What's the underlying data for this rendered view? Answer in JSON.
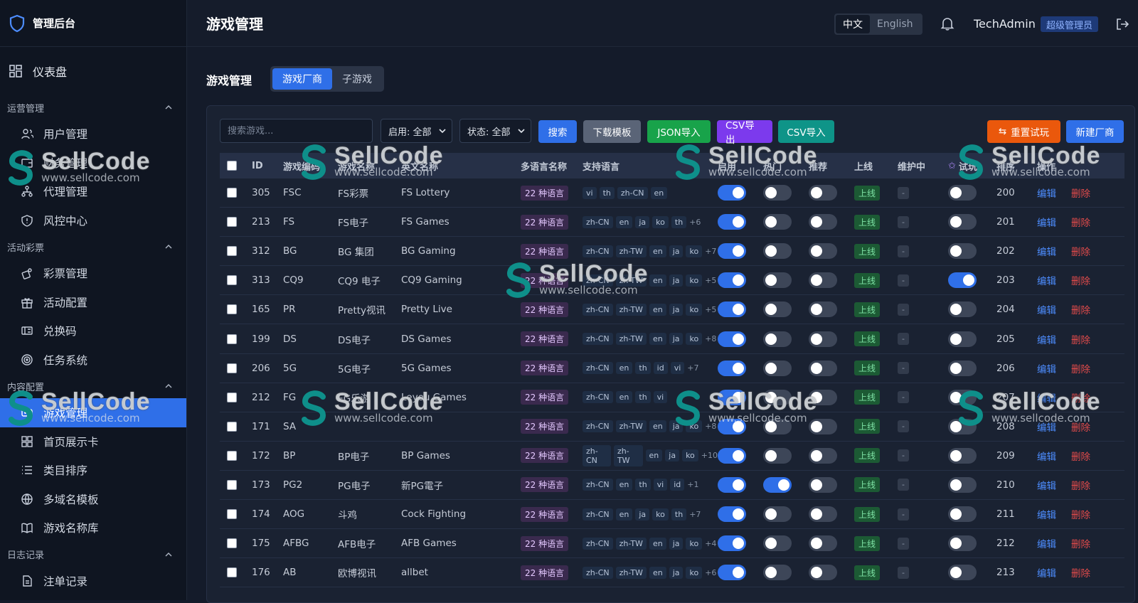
{
  "brand": {
    "title": "管理后台"
  },
  "sidebar": {
    "dashboard": "仪表盘",
    "sections": [
      {
        "title": "运营管理",
        "items": [
          "用户管理",
          "财务管理",
          "代理管理",
          "风控中心"
        ]
      },
      {
        "title": "活动彩票",
        "items": [
          "彩票管理",
          "活动配置",
          "兑换码",
          "任务系统"
        ]
      },
      {
        "title": "内容配置",
        "items": [
          "游戏管理",
          "首页展示卡",
          "类目排序",
          "多域名模板",
          "游戏名称库"
        ]
      },
      {
        "title": "日志记录",
        "items": [
          "注单记录"
        ]
      }
    ],
    "active_item": "游戏管理"
  },
  "header": {
    "title": "游戏管理",
    "lang": {
      "zh": "中文",
      "en": "English",
      "active": "中文"
    },
    "user": "TechAdmin",
    "role": "超级管理员"
  },
  "main": {
    "subtitle": "游戏管理",
    "tabs": [
      {
        "label": "游戏厂商",
        "active": true
      },
      {
        "label": "子游戏",
        "active": false
      }
    ]
  },
  "toolbar": {
    "search_placeholder": "搜索游戏...",
    "filter_enable": "启用: 全部",
    "filter_status": "状态: 全部",
    "search": "搜索",
    "download_template": "下载模板",
    "json_import": "JSON导入",
    "csv_export": "CSV导出",
    "csv_import": "CSV导入",
    "reset_trial": "重置试玩",
    "new_vendor": "新建厂商"
  },
  "table": {
    "headers": [
      "ID",
      "游戏编码",
      "游戏名称",
      "英文名称",
      "多语言名称",
      "支持语言",
      "启用",
      "热门",
      "推荐",
      "上线",
      "维护中",
      "试玩",
      "排序",
      "操作"
    ],
    "multi_label": "22 种语言",
    "online_label": "上线",
    "maint_label": "-",
    "edit_label": "编辑",
    "delete_label": "删除",
    "rows": [
      {
        "id": "305",
        "code": "FSC",
        "name": "FS彩票",
        "ename": "FS Lottery",
        "langs": [
          "vi",
          "th",
          "zh-CN",
          "en"
        ],
        "more": "",
        "t1": true,
        "t2": false,
        "t3": false,
        "trial": false,
        "sort": "200"
      },
      {
        "id": "213",
        "code": "FS",
        "name": "FS电子",
        "ename": "FS Games",
        "langs": [
          "zh-CN",
          "en",
          "ja",
          "ko",
          "th"
        ],
        "more": "+6",
        "t1": true,
        "t2": false,
        "t3": false,
        "trial": false,
        "sort": "201"
      },
      {
        "id": "312",
        "code": "BG",
        "name": "BG 集团",
        "ename": "BG Gaming",
        "langs": [
          "zh-CN",
          "zh-TW",
          "en",
          "ja",
          "ko"
        ],
        "more": "+7",
        "t1": true,
        "t2": false,
        "t3": false,
        "trial": false,
        "sort": "202"
      },
      {
        "id": "313",
        "code": "CQ9",
        "name": "CQ9 电子",
        "ename": "CQ9 Gaming",
        "langs": [
          "zh-CN",
          "zh-TW",
          "en",
          "ja",
          "ko"
        ],
        "more": "+5",
        "t1": true,
        "t2": false,
        "t3": false,
        "trial": true,
        "sort": "203"
      },
      {
        "id": "165",
        "code": "PR",
        "name": "Pretty视讯",
        "ename": "Pretty Live",
        "langs": [
          "zh-CN",
          "zh-TW",
          "en",
          "ja",
          "ko"
        ],
        "more": "+5",
        "t1": true,
        "t2": false,
        "t3": false,
        "trial": false,
        "sort": "204"
      },
      {
        "id": "199",
        "code": "DS",
        "name": "DS电子",
        "ename": "DS Games",
        "langs": [
          "zh-CN",
          "zh-TW",
          "en",
          "ja",
          "ko"
        ],
        "more": "+8",
        "t1": true,
        "t2": false,
        "t3": false,
        "trial": false,
        "sort": "205"
      },
      {
        "id": "206",
        "code": "5G",
        "name": "5G电子",
        "ename": "5G Games",
        "langs": [
          "zh-CN",
          "en",
          "th",
          "id",
          "vi"
        ],
        "more": "+7",
        "t1": true,
        "t2": false,
        "t3": false,
        "trial": false,
        "sort": "206"
      },
      {
        "id": "212",
        "code": "FG",
        "name": "FG乐游",
        "ename": "Leyou Games",
        "langs": [
          "zh-CN",
          "en",
          "th",
          "vi"
        ],
        "more": "",
        "t1": true,
        "t2": false,
        "t3": false,
        "trial": false,
        "sort": "207"
      },
      {
        "id": "171",
        "code": "SA",
        "name": "",
        "ename": "",
        "langs": [
          "zh-CN",
          "zh-TW",
          "en",
          "ja",
          "ko"
        ],
        "more": "+8",
        "t1": true,
        "t2": false,
        "t3": false,
        "trial": false,
        "sort": "208"
      },
      {
        "id": "172",
        "code": "BP",
        "name": "BP电子",
        "ename": "BP Games",
        "langs": [
          "zh-CN",
          "zh-TW",
          "en",
          "ja",
          "ko"
        ],
        "more": "+10",
        "t1": true,
        "t2": false,
        "t3": false,
        "trial": false,
        "sort": "209"
      },
      {
        "id": "173",
        "code": "PG2",
        "name": "PG电子",
        "ename": "新PG電子",
        "langs": [
          "zh-CN",
          "en",
          "th",
          "vi",
          "id"
        ],
        "more": "+1",
        "t1": true,
        "t2": true,
        "t3": false,
        "trial": false,
        "sort": "210"
      },
      {
        "id": "174",
        "code": "AOG",
        "name": "斗鸡",
        "ename": "Cock Fighting",
        "langs": [
          "zh-CN",
          "en",
          "ja",
          "ko",
          "th"
        ],
        "more": "+7",
        "t1": true,
        "t2": false,
        "t3": false,
        "trial": false,
        "sort": "211"
      },
      {
        "id": "175",
        "code": "AFBG",
        "name": "AFB电子",
        "ename": "AFB Games",
        "langs": [
          "zh-CN",
          "zh-TW",
          "en",
          "ja",
          "ko"
        ],
        "more": "+4",
        "t1": true,
        "t2": false,
        "t3": false,
        "trial": false,
        "sort": "212"
      },
      {
        "id": "176",
        "code": "AB",
        "name": "欧博视讯",
        "ename": "allbet",
        "langs": [
          "zh-CN",
          "zh-TW",
          "en",
          "ja",
          "ko"
        ],
        "more": "+6",
        "t1": true,
        "t2": false,
        "t3": false,
        "trial": false,
        "sort": "213"
      }
    ]
  },
  "watermark": {
    "title": "SellCode",
    "url": "www.sellcode.com"
  },
  "colors": {
    "accent": "#2f6fe8",
    "danger": "#e24b4b",
    "success_bg": "#1c5a34",
    "bg": "#141b2a",
    "sidebar_bg": "#0f1521"
  }
}
